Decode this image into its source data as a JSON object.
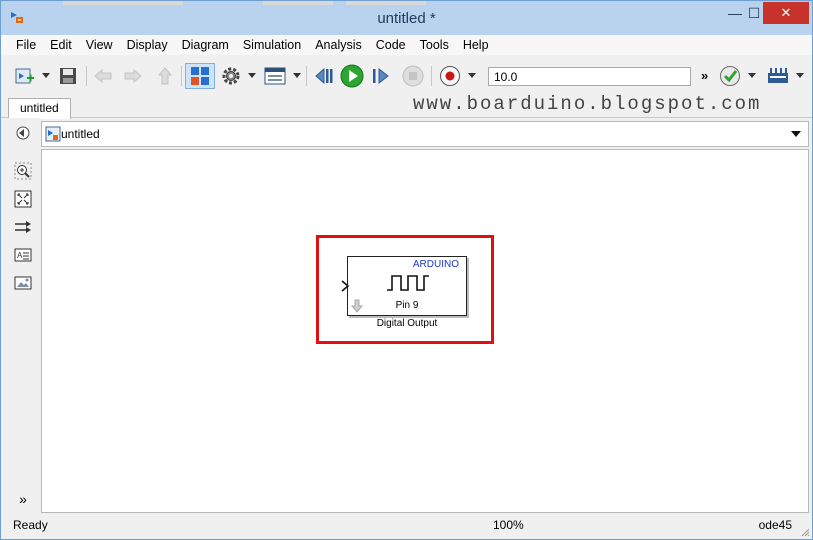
{
  "window": {
    "title": "untitled *",
    "controls": {
      "minimize": "—",
      "maximize": "☐",
      "close": "✕"
    }
  },
  "menu": [
    "File",
    "Edit",
    "View",
    "Display",
    "Diagram",
    "Simulation",
    "Analysis",
    "Code",
    "Tools",
    "Help"
  ],
  "toolbar": {
    "stop_time": "10.0",
    "overflow_label": "»"
  },
  "tabs": [
    {
      "label": "untitled",
      "active": true
    }
  ],
  "watermark": "www.boarduino.blogspot.com",
  "address": {
    "path": "untitled"
  },
  "palette": {
    "expand_label": "»"
  },
  "block": {
    "brand": "ARDUINO",
    "pin_label": "Pin 9",
    "caption": "Digital Output"
  },
  "status": {
    "left": "Ready",
    "zoom": "100%",
    "solver": "ode45"
  },
  "colors": {
    "highlight": "#e01010",
    "brand_text": "#1a37c8",
    "close_button": "#c7322a",
    "titlebar": "#b9d3ee"
  }
}
